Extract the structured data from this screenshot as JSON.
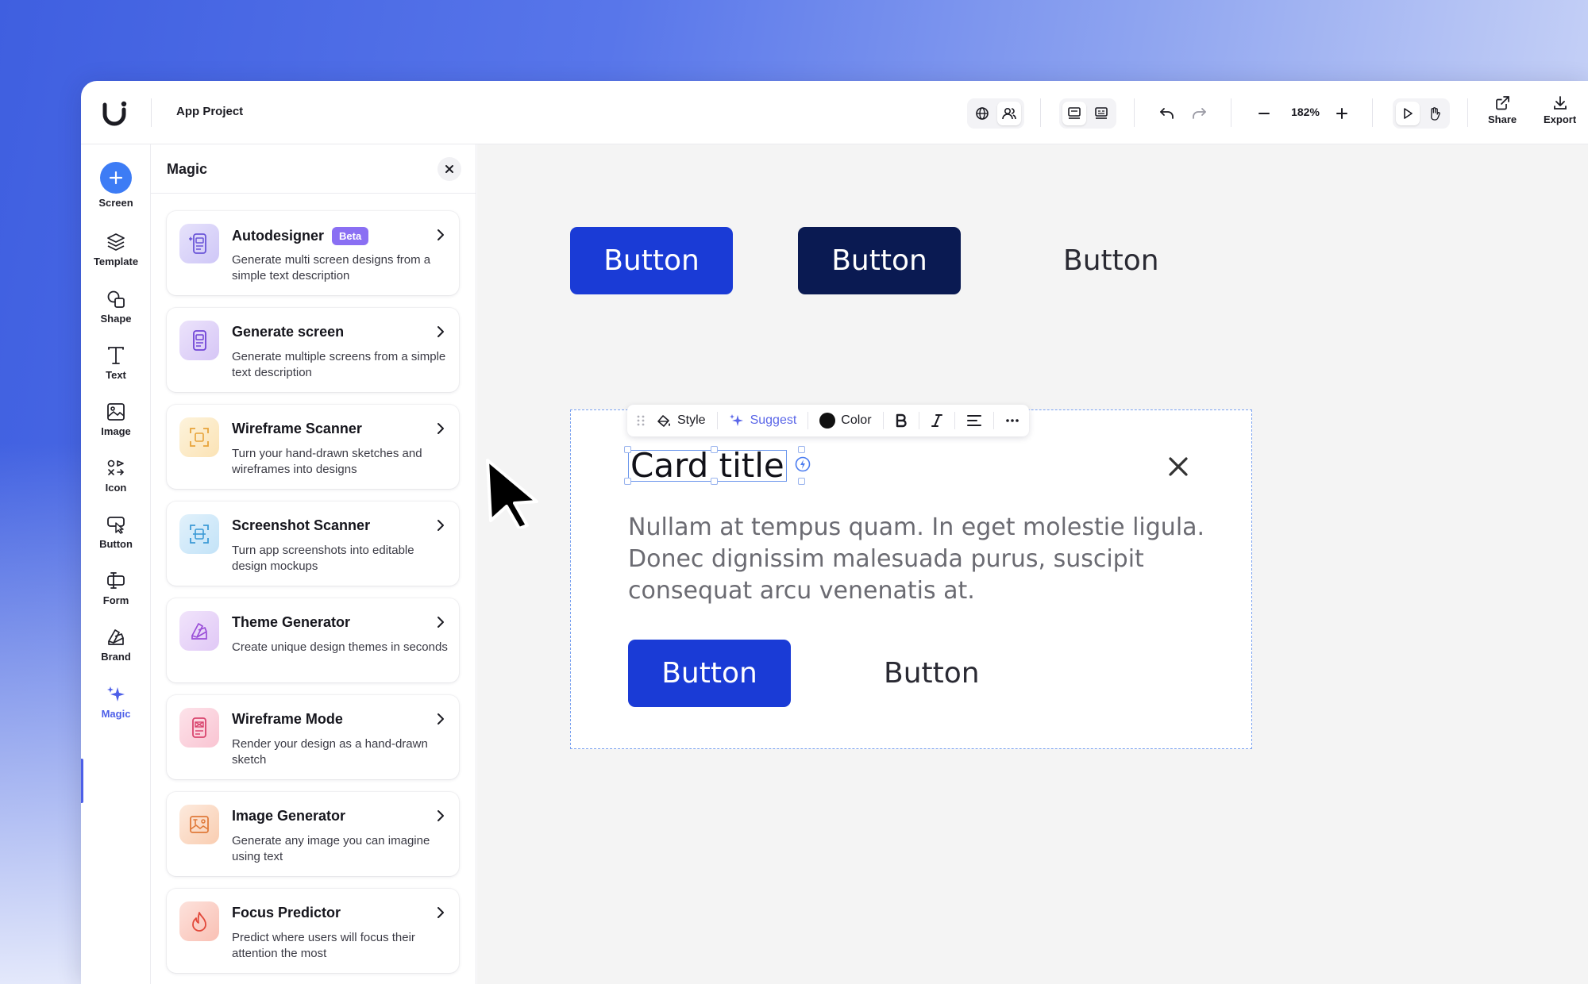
{
  "topbar": {
    "project_name": "App Project",
    "zoom": "182%",
    "share_label": "Share",
    "export_label": "Export"
  },
  "rail": {
    "items": [
      {
        "label": "Screen",
        "icon": "plus-icon"
      },
      {
        "label": "Template",
        "icon": "layers-icon"
      },
      {
        "label": "Shape",
        "icon": "shapes-icon"
      },
      {
        "label": "Text",
        "icon": "text-icon"
      },
      {
        "label": "Image",
        "icon": "image-icon"
      },
      {
        "label": "Icon",
        "icon": "icon-set-icon"
      },
      {
        "label": "Button",
        "icon": "button-cursor-icon"
      },
      {
        "label": "Form",
        "icon": "form-icon"
      },
      {
        "label": "Brand",
        "icon": "brand-icon"
      },
      {
        "label": "Magic",
        "icon": "sparkle-icon"
      }
    ],
    "active": "Magic",
    "accent_color": "#4d5fe8"
  },
  "panel": {
    "title": "Magic",
    "cards": [
      {
        "title": "Autodesigner",
        "badge": "Beta",
        "desc": "Generate multi screen designs from a simple text description",
        "icon": "autodesigner-icon"
      },
      {
        "title": "Generate screen",
        "desc": "Generate multiple screens from a simple text description",
        "icon": "generate-screen-icon"
      },
      {
        "title": "Wireframe Scanner",
        "desc": "Turn your hand-drawn sketches and wireframes into designs",
        "icon": "wireframe-scanner-icon"
      },
      {
        "title": "Screenshot Scanner",
        "desc": "Turn app screenshots into editable design mockups",
        "icon": "screenshot-scanner-icon"
      },
      {
        "title": "Theme Generator",
        "desc": "Create unique design themes in seconds",
        "icon": "theme-generator-icon"
      },
      {
        "title": "Wireframe Mode",
        "desc": "Render your design as a hand-drawn sketch",
        "icon": "wireframe-mode-icon"
      },
      {
        "title": "Image Generator",
        "desc": "Generate any image you can imagine using text",
        "icon": "image-generator-icon"
      },
      {
        "title": "Focus Predictor",
        "desc": "Predict where users will focus their attention the most",
        "icon": "flame-icon"
      }
    ]
  },
  "canvas": {
    "top_buttons": [
      "Button",
      "Button",
      "Button"
    ],
    "colors": {
      "primary": "#1a3bd6",
      "dark": "#0a1a52"
    },
    "toolbar": {
      "style_label": "Style",
      "suggest_label": "Suggest",
      "color_label": "Color"
    },
    "card": {
      "title": "Card title",
      "body": "Nullam at tempus quam. In eget molestie ligula. Donec dignissim malesuada purus, suscipit consequat arcu venenatis at.",
      "primary_button": "Button",
      "secondary_button": "Button"
    }
  }
}
